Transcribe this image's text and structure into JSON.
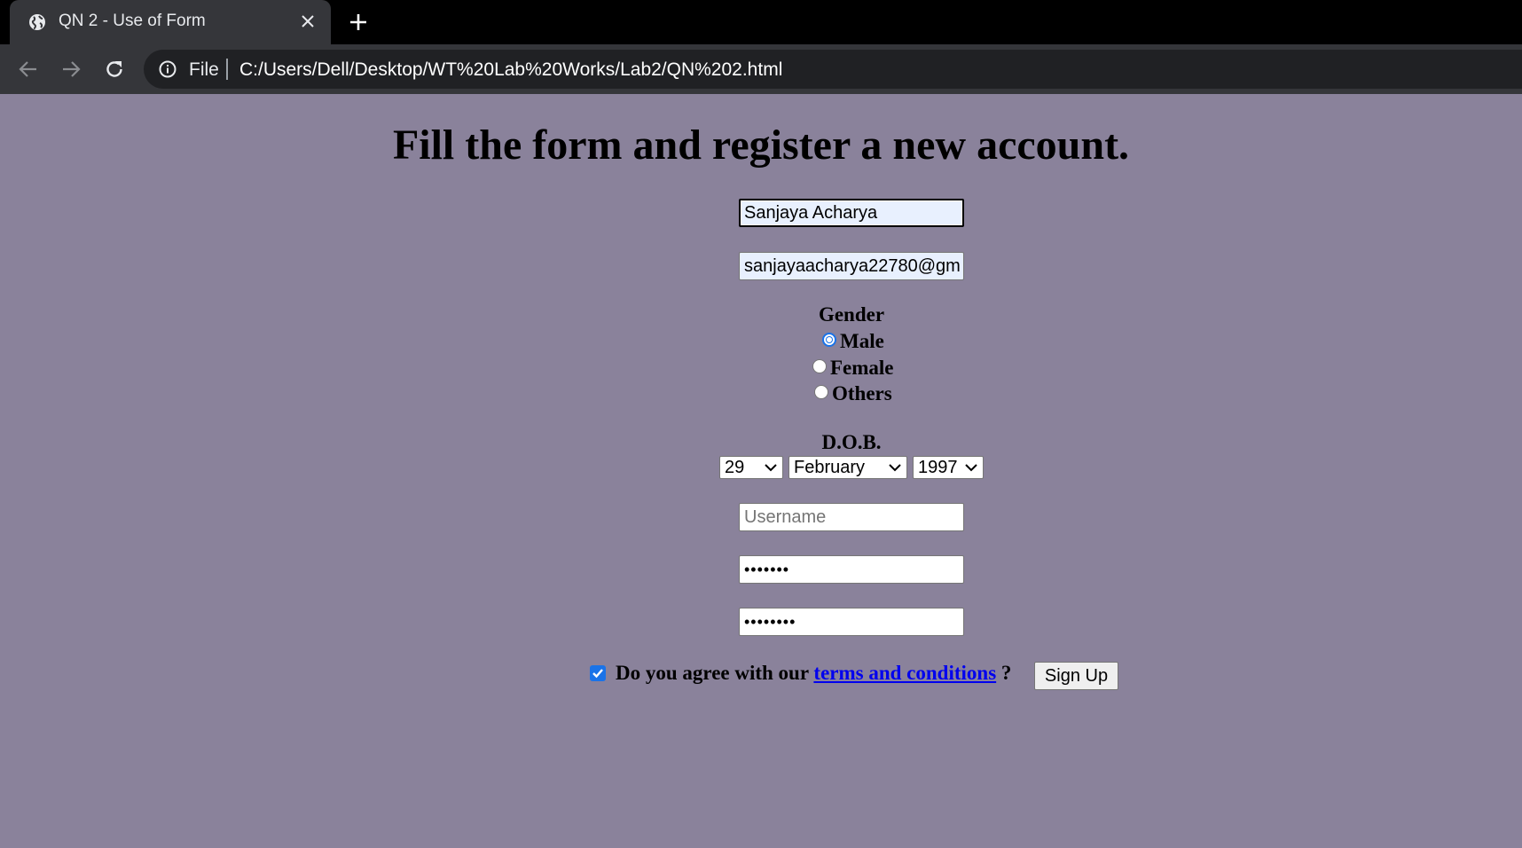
{
  "browser": {
    "tab_title": "QN 2 - Use of Form",
    "scheme_label": "File",
    "url": "C:/Users/Dell/Desktop/WT%20Lab%20Works/Lab2/QN%202.html",
    "icons": [
      "globe-icon",
      "close-icon",
      "plus-icon",
      "back-arrow-icon",
      "forward-arrow-icon",
      "reload-icon",
      "info-icon"
    ]
  },
  "page": {
    "background_color": "#8a829b",
    "heading": "Fill the form and register a new account.",
    "full_name_value": "Sanjaya Acharya",
    "email_value": "sanjayaacharya22780@gm",
    "gender_label": "Gender",
    "gender_options": [
      "Male",
      "Female",
      "Others"
    ],
    "gender_selected": "Male",
    "dob_label": "D.O.B.",
    "dob_day": "29",
    "dob_month": "February",
    "dob_year": "1997",
    "username_placeholder": "Username",
    "password_mask": "•••••••",
    "confirm_password_mask": "••••••••",
    "terms_prefix": "Do you agree with our",
    "terms_link": "terms and conditions",
    "terms_suffix": "?",
    "terms_checked": true,
    "signup_label": "Sign Up"
  }
}
